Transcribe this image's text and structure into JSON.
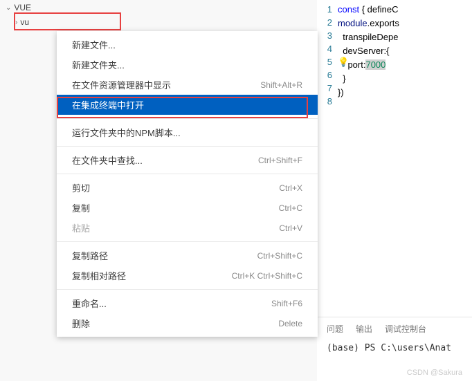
{
  "sidebar": {
    "root_label": "VUE",
    "folder_label": "vu"
  },
  "context_menu": {
    "items": [
      {
        "label": "新建文件...",
        "shortcut": "",
        "kind": "item"
      },
      {
        "label": "新建文件夹...",
        "shortcut": "",
        "kind": "item"
      },
      {
        "label": "在文件资源管理器中显示",
        "shortcut": "Shift+Alt+R",
        "kind": "item"
      },
      {
        "label": "在集成终端中打开",
        "shortcut": "",
        "kind": "selected"
      },
      {
        "kind": "separator"
      },
      {
        "label": "运行文件夹中的NPM脚本...",
        "shortcut": "",
        "kind": "item"
      },
      {
        "kind": "separator"
      },
      {
        "label": "在文件夹中查找...",
        "shortcut": "Ctrl+Shift+F",
        "kind": "item"
      },
      {
        "kind": "separator"
      },
      {
        "label": "剪切",
        "shortcut": "Ctrl+X",
        "kind": "item"
      },
      {
        "label": "复制",
        "shortcut": "Ctrl+C",
        "kind": "item"
      },
      {
        "label": "粘贴",
        "shortcut": "Ctrl+V",
        "kind": "disabled"
      },
      {
        "kind": "separator"
      },
      {
        "label": "复制路径",
        "shortcut": "Ctrl+Shift+C",
        "kind": "item"
      },
      {
        "label": "复制相对路径",
        "shortcut": "Ctrl+K Ctrl+Shift+C",
        "kind": "item"
      },
      {
        "kind": "separator"
      },
      {
        "label": "重命名...",
        "shortcut": "Shift+F6",
        "kind": "item"
      },
      {
        "label": "删除",
        "shortcut": "Delete",
        "kind": "item"
      }
    ]
  },
  "code": {
    "line1_kw": "const",
    "line1_rest": " { defineC",
    "line2_a": "module",
    "line2_b": ".exports ",
    "line3": "  transpileDepe",
    "line4": "  devServer:{",
    "line5_a": "    port:",
    "line5_b": "7000",
    "line6": "  }",
    "line7": "})",
    "lines": [
      "1",
      "2",
      "3",
      "4",
      "5",
      "6",
      "7",
      "8"
    ]
  },
  "bottom": {
    "tabs": [
      "问题",
      "输出",
      "调试控制台"
    ],
    "terminal": "(base) PS C:\\users\\Anat"
  },
  "watermark": "CSDN @Sakura"
}
